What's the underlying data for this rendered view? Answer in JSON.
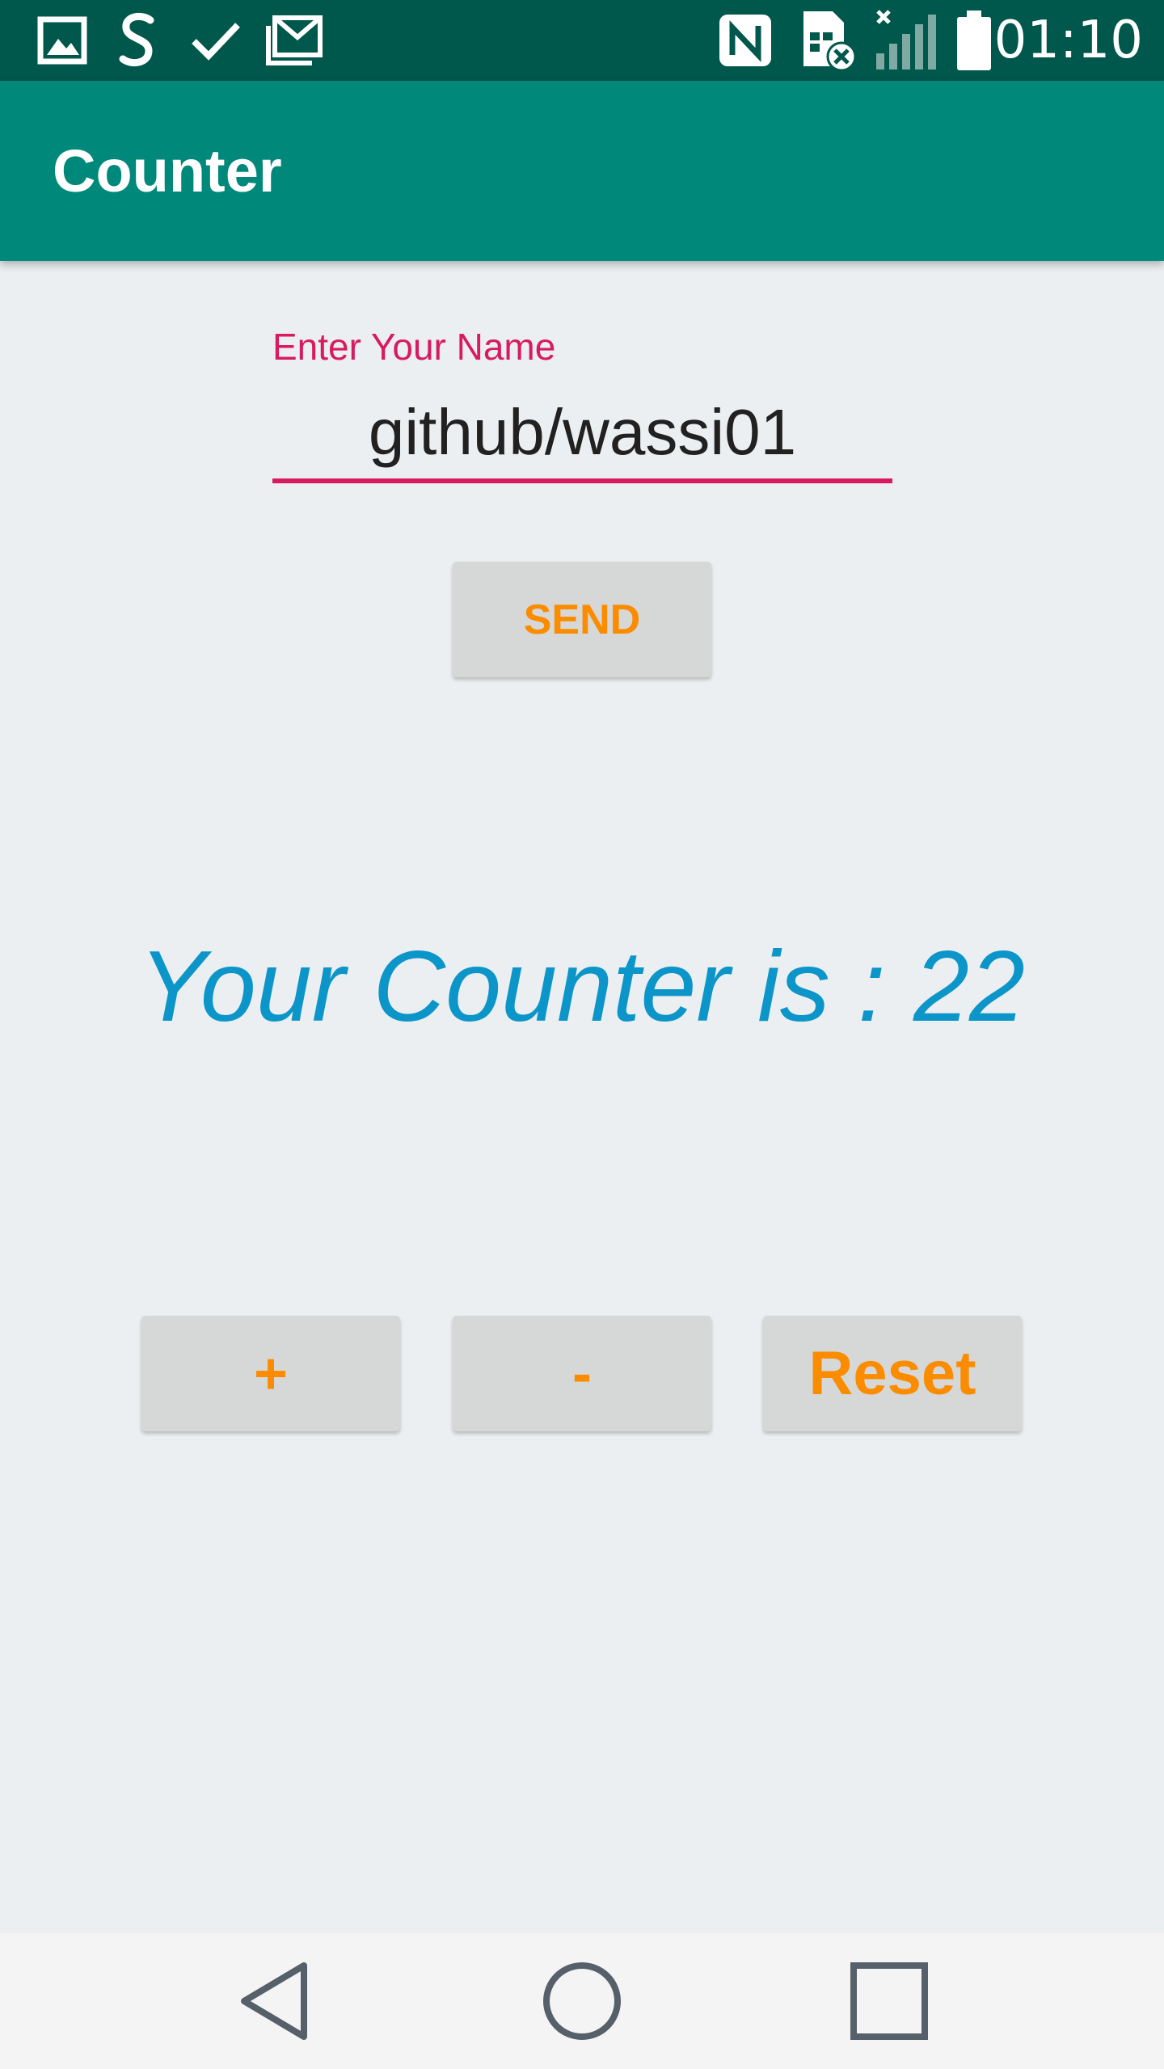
{
  "status_bar": {
    "time": "01:10",
    "left_icons": [
      "gallery-icon",
      "s-app-icon",
      "check-icon",
      "mail-icon"
    ],
    "right_icons": [
      "nfc-icon",
      "sim-error-icon",
      "signal-icon",
      "battery-icon"
    ]
  },
  "app_bar": {
    "title": "Counter",
    "color": "#00897b"
  },
  "form": {
    "label": "Enter Your Name",
    "value": "github/wassi01",
    "send_label": "SEND"
  },
  "counter": {
    "text": "Your Counter is : 22"
  },
  "controls": {
    "plus_label": "+",
    "minus_label": "-",
    "reset_label": "Reset"
  },
  "colors": {
    "accent": "#d81b60",
    "button_text": "#fb8c00",
    "counter_text": "#0b95c9"
  },
  "nav_bar": {
    "buttons": [
      "back-icon",
      "home-icon",
      "recents-icon"
    ]
  }
}
